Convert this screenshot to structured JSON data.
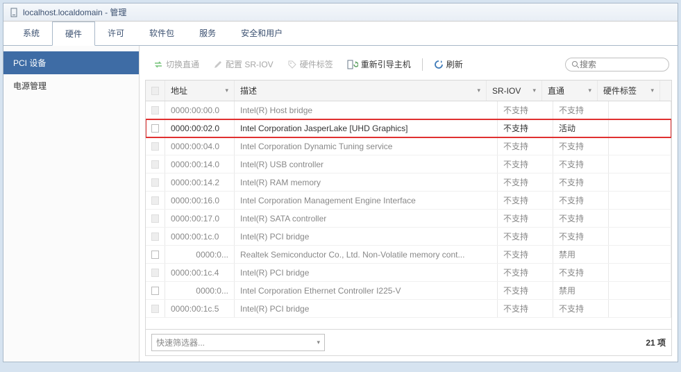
{
  "window": {
    "title": "localhost.localdomain - 管理"
  },
  "tabs": {
    "items": [
      "系统",
      "硬件",
      "许可",
      "软件包",
      "服务",
      "安全和用户"
    ],
    "active_index": 1
  },
  "sidebar": {
    "items": [
      {
        "label": "PCI 设备",
        "active": true
      },
      {
        "label": "电源管理",
        "active": false
      }
    ]
  },
  "toolbar": {
    "toggle_passthrough": "切换直通",
    "config_sriov": "配置 SR-IOV",
    "hw_tag": "硬件标签",
    "reboot_host": "重新引导主机",
    "refresh": "刷新"
  },
  "search": {
    "placeholder": "搜索"
  },
  "table": {
    "headers": {
      "address": "地址",
      "description": "描述",
      "sriov": "SR-IOV",
      "passthrough": "直通",
      "hw_tag": "硬件标签"
    },
    "rows": [
      {
        "cb": "disabled",
        "indent": 0,
        "address": "0000:00:00.0",
        "description": "Intel(R) Host bridge",
        "sriov": "不支持",
        "passthrough": "不支持",
        "highlighted": false
      },
      {
        "cb": "enabled",
        "indent": 0,
        "address": "0000:00:02.0",
        "description": "Intel Corporation JasperLake [UHD Graphics]",
        "sriov": "不支持",
        "passthrough": "活动",
        "highlighted": true
      },
      {
        "cb": "disabled",
        "indent": 0,
        "address": "0000:00:04.0",
        "description": "Intel Corporation Dynamic Tuning service",
        "sriov": "不支持",
        "passthrough": "不支持",
        "highlighted": false
      },
      {
        "cb": "disabled",
        "indent": 0,
        "address": "0000:00:14.0",
        "description": "Intel(R) USB controller",
        "sriov": "不支持",
        "passthrough": "不支持",
        "highlighted": false
      },
      {
        "cb": "disabled",
        "indent": 0,
        "address": "0000:00:14.2",
        "description": "Intel(R) RAM memory",
        "sriov": "不支持",
        "passthrough": "不支持",
        "highlighted": false
      },
      {
        "cb": "disabled",
        "indent": 0,
        "address": "0000:00:16.0",
        "description": "Intel Corporation Management Engine Interface",
        "sriov": "不支持",
        "passthrough": "不支持",
        "highlighted": false
      },
      {
        "cb": "disabled",
        "indent": 0,
        "address": "0000:00:17.0",
        "description": "Intel(R) SATA controller",
        "sriov": "不支持",
        "passthrough": "不支持",
        "highlighted": false
      },
      {
        "cb": "disabled",
        "indent": 0,
        "address": "0000:00:1c.0",
        "description": "Intel(R) PCI bridge",
        "sriov": "不支持",
        "passthrough": "不支持",
        "highlighted": false
      },
      {
        "cb": "enabled",
        "indent": 1,
        "address": "0000:0...",
        "description": "Realtek Semiconductor Co., Ltd. Non-Volatile memory cont...",
        "sriov": "不支持",
        "passthrough": "禁用",
        "highlighted": false
      },
      {
        "cb": "disabled",
        "indent": 0,
        "address": "0000:00:1c.4",
        "description": "Intel(R) PCI bridge",
        "sriov": "不支持",
        "passthrough": "不支持",
        "highlighted": false
      },
      {
        "cb": "enabled",
        "indent": 1,
        "address": "0000:0...",
        "description": "Intel Corporation Ethernet Controller I225-V",
        "sriov": "不支持",
        "passthrough": "禁用",
        "highlighted": false
      },
      {
        "cb": "disabled",
        "indent": 0,
        "address": "0000:00:1c.5",
        "description": "Intel(R) PCI bridge",
        "sriov": "不支持",
        "passthrough": "不支持",
        "highlighted": false
      }
    ],
    "footer": {
      "filter_placeholder": "快速筛选器...",
      "count_label": "21 项"
    }
  }
}
